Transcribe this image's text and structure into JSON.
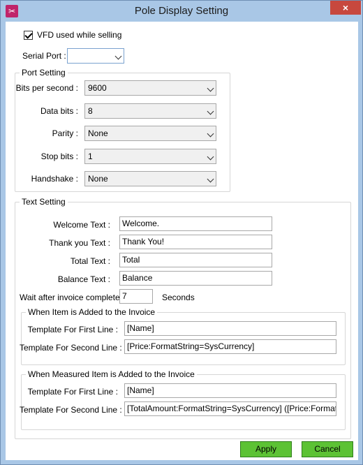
{
  "window": {
    "title": "Pole Display Setting",
    "icon": "scissors-icon",
    "close_glyph": "×"
  },
  "vfd_checkbox": {
    "label": "VFD used while selling",
    "checked": true
  },
  "serial_port": {
    "label": "Serial Port :",
    "value": ""
  },
  "port_setting": {
    "title": "Port Setting",
    "fields": [
      {
        "label": "Bits per second :",
        "value": "9600"
      },
      {
        "label": "Data bits :",
        "value": "8"
      },
      {
        "label": "Parity :",
        "value": "None"
      },
      {
        "label": "Stop bits :",
        "value": "1"
      },
      {
        "label": "Handshake :",
        "value": "None"
      }
    ]
  },
  "text_setting": {
    "title": "Text Setting",
    "fields": [
      {
        "label": "Welcome Text :",
        "value": "Welcome."
      },
      {
        "label": "Thank you Text :",
        "value": "Thank You!"
      },
      {
        "label": "Total Text :",
        "value": "Total"
      },
      {
        "label": "Balance Text :",
        "value": "Balance"
      }
    ],
    "wait_label": "Wait after invoice complete :",
    "wait_value": "7",
    "wait_unit": "Seconds"
  },
  "item_added": {
    "title": "When Item is Added to the Invoice",
    "first_label": "Template For First Line :",
    "first_value": "[Name]",
    "second_label": "Template For Second Line :",
    "second_value": "[Price:FormatString=SysCurrency]"
  },
  "measured_added": {
    "title": "When Measured Item is Added to the Invoice",
    "first_label": "Template For First Line :",
    "first_value": "[Name]",
    "second_label": "Template For Second Line :",
    "second_value": "[TotalAmount:FormatString=SysCurrency] ([Price:FormatString=SysCurrency]"
  },
  "buttons": {
    "apply": "Apply",
    "cancel": "Cancel"
  },
  "colors": {
    "titlebar": "#a9c7e6",
    "close": "#c7483e",
    "button": "#5cc234"
  }
}
